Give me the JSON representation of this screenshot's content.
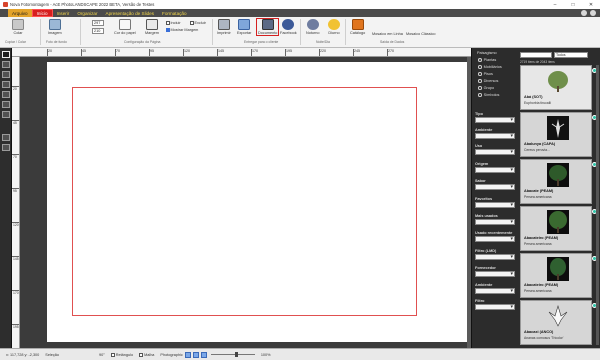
{
  "window": {
    "title": "Nova Fotomontagem - AcE PhotoLANDSCAPE 2022 BETA, Versão de Testes",
    "controls": [
      "–",
      "□",
      "✕"
    ]
  },
  "tabs": [
    {
      "label": "Arquivo"
    },
    {
      "label": "Início"
    },
    {
      "label": "Inserir"
    },
    {
      "label": "Organizar"
    },
    {
      "label": "Apresentação de Slides"
    },
    {
      "label": "Formatação"
    }
  ],
  "ribbon": {
    "colar": "Colar",
    "imagem": "Imagem",
    "cor_papel": "Cor do papel",
    "margem": "Margem",
    "incluir": "Incluir",
    "excluir": "Excluir",
    "mostrar_margem": "Mostrar Margem",
    "size_w": "297",
    "size_h": "210",
    "imprimir": "Imprimir",
    "exportar": "Exportar",
    "documento": "Documento",
    "facebook": "Facebook",
    "noturno": "Noturno",
    "diurno": "Diurno",
    "catalogo": "Catálogo",
    "mosaico": "Mosaico em Linha",
    "mosaico_classico": "Mosaico Clássico",
    "groups": {
      "copiar": "Copiar / Colar",
      "foto_fundo": "Foto de fundo",
      "config_pagina": "Configuração da Página",
      "entregar": "Entregar para o cliente",
      "noite_dia": "Noite/Dia",
      "saida": "Saída de Dados"
    }
  },
  "ruler": {
    "top": [
      "20",
      "45",
      "70",
      "95",
      "120",
      "145",
      "170",
      "195",
      "220",
      "245",
      "270"
    ],
    "left": [
      "20",
      "45",
      "70",
      "95",
      "120",
      "145",
      "170",
      "195",
      "220"
    ]
  },
  "panel": {
    "category_title": "Paisagismo",
    "radios": [
      {
        "label": "Plantas",
        "selected": true
      },
      {
        "label": "Mobiliários",
        "selected": false
      },
      {
        "label": "Pisos",
        "selected": false
      },
      {
        "label": "Diversos",
        "selected": false
      },
      {
        "label": "Grupo",
        "selected": false
      },
      {
        "label": "Símbolos",
        "selected": false
      }
    ],
    "search_placeholder": "",
    "search_scope": "Todos",
    "count_text": "2719 itens de 2043 itens",
    "filters": [
      {
        "label": "Tipo"
      },
      {
        "label": "Ambiente"
      },
      {
        "label": "Uso"
      },
      {
        "label": "Origem"
      },
      {
        "label": "Sabor"
      },
      {
        "label": "Favoritos"
      },
      {
        "label": "Mais usados"
      },
      {
        "label": "Usado recentemente"
      },
      {
        "label": "Filtro (LMD)"
      },
      {
        "label": "Fornecedor"
      },
      {
        "label": "Ambiente"
      },
      {
        "label": "Filtro"
      }
    ],
    "plants": [
      {
        "name": "Abá (SOT)",
        "scientific": "Euphorbia tirucalli"
      },
      {
        "name": "Abalunya (CAPA)",
        "scientific": "Cereus peruvia..."
      },
      {
        "name": "Abacate (PEAM)",
        "scientific": "Persea americana"
      },
      {
        "name": "Abacateiro (PEAM)",
        "scientific": "Persea americana"
      },
      {
        "name": "Abacateiro (PEAM)",
        "scientific": "Persea americana"
      },
      {
        "name": "Abacaxi (ANCO)",
        "scientific": "Ananas comosus 'Tricolor'"
      }
    ]
  },
  "status": {
    "coords": "x: 117,728 y: -2,300",
    "selecao": "Seleção",
    "angle": "90°",
    "retangulo": "Retângulo",
    "malha": "Malha",
    "photographic": "Photographic",
    "zoom": "100%"
  },
  "colors": {
    "accent_yellow": "#f2d64a",
    "active_tab": "#d61f1f",
    "margin_line": "#e05050",
    "badge": "#2fc3a8"
  }
}
